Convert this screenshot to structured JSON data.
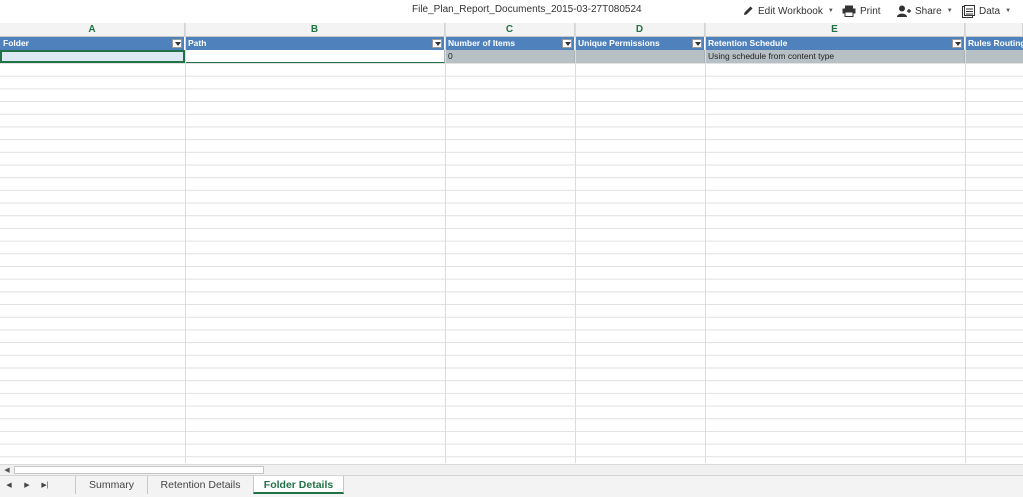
{
  "document": {
    "title": "File_Plan_Report_Documents_2015-03-27T080524"
  },
  "toolbar": {
    "edit_workbook": "Edit Workbook",
    "print": "Print",
    "share": "Share",
    "data": "Data"
  },
  "columns": [
    "A",
    "B",
    "C",
    "D",
    "E"
  ],
  "table": {
    "headers": [
      "Folder",
      "Path",
      "Number of Items",
      "Unique Permissions",
      "Retention Schedule",
      "Rules Routing"
    ],
    "rows": [
      [
        "",
        "",
        "0",
        "",
        "Using schedule from content type",
        ""
      ]
    ]
  },
  "sheets": {
    "tabs": [
      "Summary",
      "Retention Details",
      "Folder Details"
    ],
    "active": "Folder Details"
  },
  "colors": {
    "accent": "#217346",
    "table_header": "#4f81bd",
    "data_row": "#b7c0c5"
  }
}
